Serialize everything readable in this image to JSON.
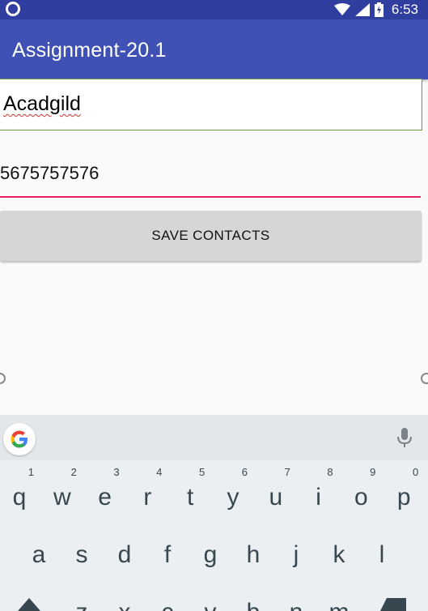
{
  "status_bar": {
    "time": "6:53",
    "icons": [
      "wifi-icon",
      "signal-icon",
      "battery-charging-icon"
    ]
  },
  "app_bar": {
    "title": "Assignment-20.1"
  },
  "form": {
    "name_value": "Acadgild",
    "phone_value": "5675757576",
    "save_label": "SAVE CONTACTS"
  },
  "keyboard": {
    "row1": [
      {
        "letter": "q",
        "num": "1"
      },
      {
        "letter": "w",
        "num": "2"
      },
      {
        "letter": "e",
        "num": "3"
      },
      {
        "letter": "r",
        "num": "4"
      },
      {
        "letter": "t",
        "num": "5"
      },
      {
        "letter": "y",
        "num": "6"
      },
      {
        "letter": "u",
        "num": "7"
      },
      {
        "letter": "i",
        "num": "8"
      },
      {
        "letter": "o",
        "num": "9"
      },
      {
        "letter": "p",
        "num": "0"
      }
    ],
    "row2": [
      "a",
      "s",
      "d",
      "f",
      "g",
      "h",
      "j",
      "k",
      "l"
    ],
    "row3_partial": [
      "z",
      "x",
      "c",
      "v",
      "b",
      "n",
      "m"
    ]
  },
  "colors": {
    "status_bar": "#303f9f",
    "app_bar": "#3f51b5",
    "accent": "#e91e63",
    "button": "#d6d6d6",
    "keyboard_bg": "#eceff1"
  }
}
